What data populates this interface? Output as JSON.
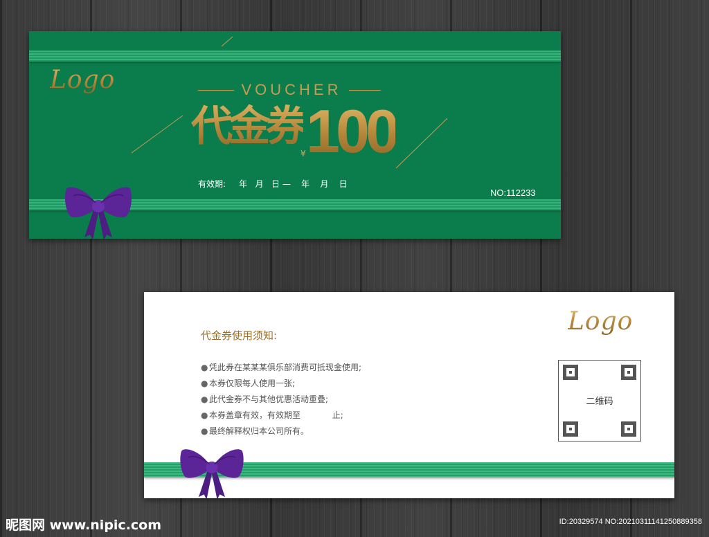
{
  "front": {
    "logo": "Logo",
    "voucher_word": "VOUCHER",
    "title": "代金券",
    "currency": "¥",
    "amount": "100",
    "validity": "有效期:     年   月   日 —    年    月    日",
    "serial": "NO:112233"
  },
  "back": {
    "notice_title": "代金券使用须知:",
    "rules": [
      "凭此券在某某某俱乐部消费可抵现金使用;",
      "本券仅限每人使用一张;",
      "此代金券不与其他优惠活动重叠;",
      "本券盖章有效，有效期至            止;",
      "最终解释权归本公司所有。"
    ],
    "bullet": "●",
    "logo": "Logo",
    "qr_label": "二维码"
  },
  "watermark": {
    "site": "昵图网 www.nipic.com",
    "id": "ID:20329574 NO:20210311141250889358"
  },
  "colors": {
    "front_green": "#0b7d4c",
    "stripe_green": "#38b27a",
    "gold": "#b98a3c",
    "bow_purple": "#5b2597",
    "background": "#3a3a3a"
  },
  "icons": [
    "bow-ribbon-icon",
    "qr-code-icon"
  ]
}
